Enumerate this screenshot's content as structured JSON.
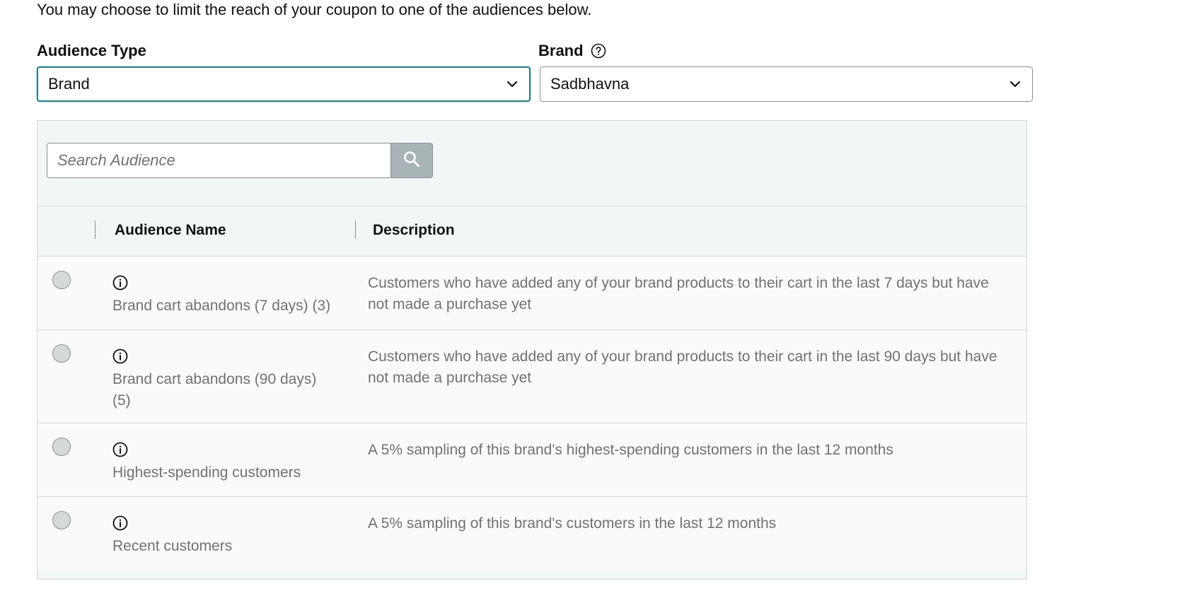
{
  "intro_text": "You may choose to limit the reach of your coupon to one of the audiences below.",
  "audience_type": {
    "label": "Audience Type",
    "value": "Brand"
  },
  "brand": {
    "label": "Brand",
    "value": "Sadbhavna"
  },
  "search": {
    "placeholder": "Search Audience"
  },
  "table": {
    "headers": {
      "name": "Audience Name",
      "description": "Description"
    },
    "rows": [
      {
        "name": "Brand cart abandons (7 days) (3)",
        "description": "Customers who have added any of your brand products to their cart in the last 7 days but have not made a purchase yet"
      },
      {
        "name": "Brand cart abandons (90 days) (5)",
        "description": "Customers who have added any of your brand products to their cart in the last 90 days but have not made a purchase yet"
      },
      {
        "name": "Highest-spending customers",
        "description": "A 5% sampling of this brand's highest-spending customers in the last 12 months"
      },
      {
        "name": "Recent customers",
        "description": "A 5% sampling of this brand's customers in the last 12 months"
      }
    ]
  },
  "colors": {
    "focus_border": "#2f7f86",
    "panel_bg": "#f3f6f7",
    "search_button": "#a9b4b6",
    "muted_text": "#6f7373"
  },
  "icons": {
    "help": "question-circle-icon",
    "chevron": "chevron-down-icon",
    "search": "search-icon",
    "info": "info-icon"
  }
}
